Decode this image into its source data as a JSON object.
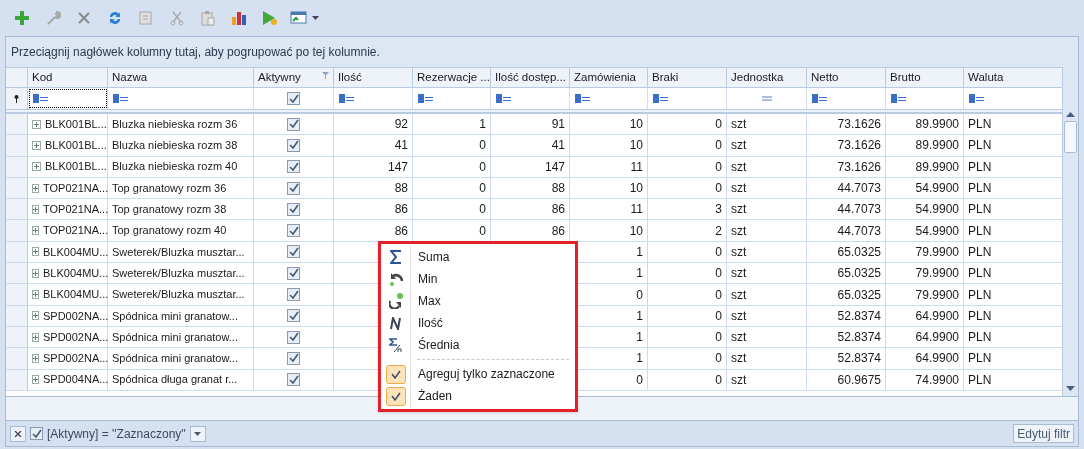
{
  "toolbar": [
    {
      "kind": "add",
      "disabled": false
    },
    {
      "kind": "edit",
      "disabled": true
    },
    {
      "kind": "delete",
      "disabled": true
    },
    {
      "kind": "refresh",
      "disabled": false
    },
    {
      "kind": "copy",
      "disabled": true
    },
    {
      "kind": "cut",
      "disabled": true
    },
    {
      "kind": "paste",
      "disabled": true
    },
    {
      "kind": "chart",
      "disabled": false
    },
    {
      "kind": "run",
      "disabled": false
    },
    {
      "kind": "export",
      "disabled": false
    }
  ],
  "group_panel": {
    "hint": "Przeciągnij nagłówek kolumny tutaj, aby pogrupować po tej kolumnie."
  },
  "columns": [
    {
      "label": "Kod",
      "kind": "text",
      "filtered": false
    },
    {
      "label": "Nazwa",
      "kind": "text",
      "filtered": false
    },
    {
      "label": "Aktywny",
      "kind": "check",
      "filtered": true
    },
    {
      "label": "Ilość",
      "kind": "number",
      "filtered": false
    },
    {
      "label": "Rezerwacje ...",
      "kind": "number",
      "filtered": false
    },
    {
      "label": "Ilość dostęp...",
      "kind": "number",
      "filtered": false
    },
    {
      "label": "Zamówienia",
      "kind": "number",
      "filtered": false
    },
    {
      "label": "Braki",
      "kind": "number",
      "filtered": false
    },
    {
      "label": "Jednostka",
      "kind": "unit",
      "filtered": false
    },
    {
      "label": "Netto",
      "kind": "number",
      "filtered": false
    },
    {
      "label": "Brutto",
      "kind": "number",
      "filtered": false
    },
    {
      "label": "Waluta",
      "kind": "text",
      "filtered": false
    }
  ],
  "filter_row": {
    "active": true
  },
  "rows": [
    {
      "code": "BLK001BL...",
      "name": "Bluzka niebieska rozm 36",
      "active": true,
      "cells": [
        "92",
        "1",
        "91",
        "10",
        "0",
        "szt",
        "73.1626",
        "89.9900",
        "PLN"
      ]
    },
    {
      "code": "BLK001BL...",
      "name": "Bluzka niebieska rozm 38",
      "active": true,
      "cells": [
        "41",
        "0",
        "41",
        "10",
        "0",
        "szt",
        "73.1626",
        "89.9900",
        "PLN"
      ]
    },
    {
      "code": "BLK001BL...",
      "name": "Bluzka niebieska rozm 40",
      "active": true,
      "cells": [
        "147",
        "0",
        "147",
        "11",
        "0",
        "szt",
        "73.1626",
        "89.9900",
        "PLN"
      ]
    },
    {
      "code": "TOP021NA...",
      "name": "Top granatowy rozm 36",
      "active": true,
      "cells": [
        "88",
        "0",
        "88",
        "10",
        "0",
        "szt",
        "44.7073",
        "54.9900",
        "PLN"
      ]
    },
    {
      "code": "TOP021NA...",
      "name": "Top granatowy rozm 38",
      "active": true,
      "cells": [
        "86",
        "0",
        "86",
        "11",
        "3",
        "szt",
        "44.7073",
        "54.9900",
        "PLN"
      ]
    },
    {
      "code": "TOP021NA...",
      "name": "Top granatowy rozm 40",
      "active": true,
      "cells": [
        "86",
        "0",
        "86",
        "10",
        "2",
        "szt",
        "44.7073",
        "54.9900",
        "PLN"
      ]
    },
    {
      "code": "BLK004MU...",
      "name": "Sweterek/Bluzka musztar...",
      "active": true,
      "cells": [
        null,
        null,
        null,
        "1",
        "0",
        "szt",
        "65.0325",
        "79.9900",
        "PLN"
      ]
    },
    {
      "code": "BLK004MU...",
      "name": "Sweterek/Bluzka musztar...",
      "active": true,
      "cells": [
        null,
        null,
        null,
        "1",
        "0",
        "szt",
        "65.0325",
        "79.9900",
        "PLN"
      ]
    },
    {
      "code": "BLK004MU...",
      "name": "Sweterek/Bluzka musztar...",
      "active": true,
      "cells": [
        null,
        null,
        null,
        "0",
        "0",
        "szt",
        "65.0325",
        "79.9900",
        "PLN"
      ]
    },
    {
      "code": "SPD002NA...",
      "name": "Spódnica mini granatow...",
      "active": true,
      "cells": [
        null,
        null,
        null,
        "1",
        "0",
        "szt",
        "52.8374",
        "64.9900",
        "PLN"
      ]
    },
    {
      "code": "SPD002NA...",
      "name": "Spódnica mini granatow...",
      "active": true,
      "cells": [
        null,
        null,
        null,
        "1",
        "0",
        "szt",
        "52.8374",
        "64.9900",
        "PLN"
      ]
    },
    {
      "code": "SPD002NA...",
      "name": "Spódnica mini granatow...",
      "active": true,
      "cells": [
        null,
        null,
        null,
        "1",
        "0",
        "szt",
        "52.8374",
        "64.9900",
        "PLN"
      ]
    },
    {
      "code": "SPD004NA...",
      "name": "Spódnica długa granat r...",
      "active": true,
      "cells": [
        null,
        null,
        null,
        "0",
        "0",
        "szt",
        "60.9675",
        "74.9900",
        "PLN"
      ]
    }
  ],
  "context_menu": {
    "items": [
      {
        "label": "Suma",
        "kind": "sum"
      },
      {
        "label": "Min",
        "kind": "min"
      },
      {
        "label": "Max",
        "kind": "max"
      },
      {
        "label": "Ilość",
        "kind": "count"
      },
      {
        "label": "Średnia",
        "kind": "average"
      }
    ],
    "options": [
      {
        "label": "Agreguj tylko zaznaczone",
        "checked": true
      },
      {
        "label": "Żaden",
        "checked": true
      }
    ]
  },
  "filter_bar": {
    "enabled": true,
    "expression": "[Aktywny] = ''Zaznaczony''",
    "edit_button": "Edytuj filtr"
  }
}
